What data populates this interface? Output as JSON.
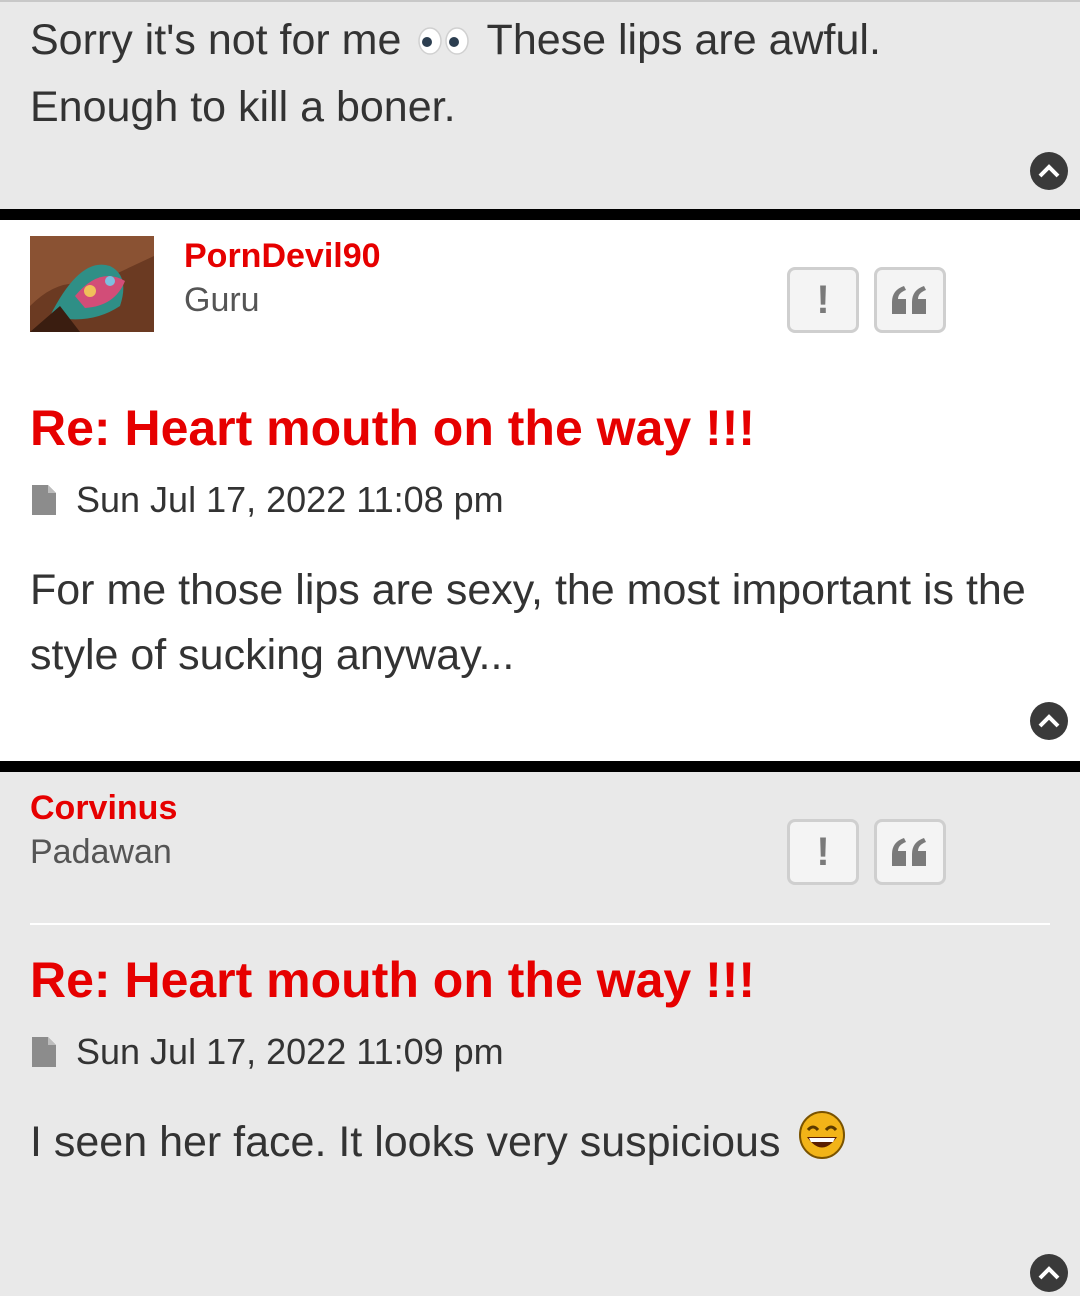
{
  "posts": [
    {
      "body_line1_a": "Sorry it's not for me",
      "body_line1_b": "These lips are awful.",
      "body_line2": "Enough to kill a boner.",
      "eyes_icon": "eyes-emoji"
    },
    {
      "username": "PornDevil90",
      "rank": "Guru",
      "report_label": "!",
      "title": "Re: Heart mouth on the way !!!",
      "date": "Sun Jul 17, 2022 11:08 pm",
      "body": "For me those lips are sexy, the most important is the style of sucking anyway..."
    },
    {
      "username": "Corvinus",
      "rank": "Padawan",
      "report_label": "!",
      "title": "Re: Heart mouth on the way !!!",
      "date": "Sun Jul 17, 2022 11:09 pm",
      "body": "I seen her face. It looks very suspicious",
      "laugh_icon": "laughing-emoji"
    }
  ],
  "colors": {
    "accent": "#e60000",
    "alt_bg": "#e9e9e9",
    "white_bg": "#ffffff",
    "separator": "#000000"
  }
}
